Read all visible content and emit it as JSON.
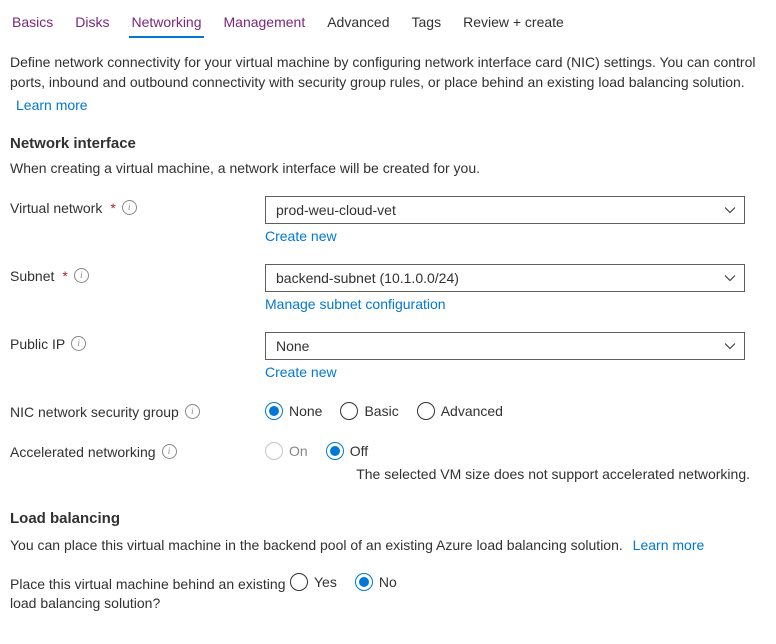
{
  "tabs": {
    "basics": "Basics",
    "disks": "Disks",
    "networking": "Networking",
    "management": "Management",
    "advanced": "Advanced",
    "tags": "Tags",
    "review": "Review + create"
  },
  "intro": {
    "text": "Define network connectivity for your virtual machine by configuring network interface card (NIC) settings. You can control ports, inbound and outbound connectivity with security group rules, or place behind an existing load balancing solution.",
    "learn_more": "Learn more"
  },
  "section_network_interface": {
    "title": "Network interface",
    "subtext": "When creating a virtual machine, a network interface will be created for you."
  },
  "fields": {
    "virtual_network": {
      "label": "Virtual network",
      "value": "prod-weu-cloud-vet",
      "sublink": "Create new"
    },
    "subnet": {
      "label": "Subnet",
      "value": "backend-subnet (10.1.0.0/24)",
      "sublink": "Manage subnet configuration"
    },
    "public_ip": {
      "label": "Public IP",
      "value": "None",
      "sublink": "Create new"
    },
    "nsg": {
      "label": "NIC network security group",
      "options": {
        "none": "None",
        "basic": "Basic",
        "advanced": "Advanced"
      }
    },
    "accel_net": {
      "label": "Accelerated networking",
      "options": {
        "on": "On",
        "off": "Off"
      },
      "note": "The selected VM size does not support accelerated networking."
    }
  },
  "section_load_balancing": {
    "title": "Load balancing",
    "intro": "You can place this virtual machine in the backend pool of an existing Azure load balancing solution.",
    "learn_more": "Learn more",
    "question": "Place this virtual machine behind an existing load balancing solution?",
    "options": {
      "yes": "Yes",
      "no": "No"
    }
  }
}
